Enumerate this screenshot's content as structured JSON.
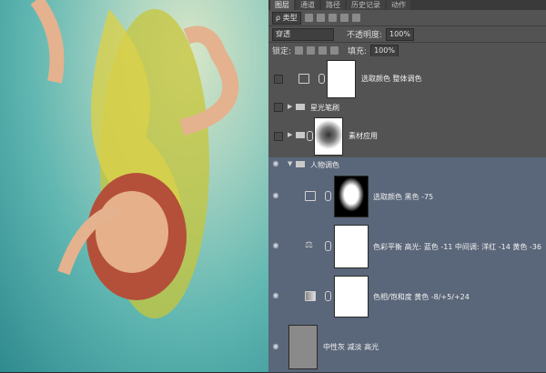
{
  "tabs": [
    "图层",
    "通道",
    "路径",
    "历史记录",
    "动作"
  ],
  "filter": {
    "label": "ρ 类型"
  },
  "blend": {
    "mode": "穿透",
    "opacity_label": "不透明度:",
    "opacity": "100%"
  },
  "lock": {
    "label": "锁定:",
    "fill_label": "填充:",
    "fill": "100%"
  },
  "layers": [
    {
      "name": "选取颜色 整体调色"
    },
    {
      "name": "星光笔刷"
    },
    {
      "name": "素材应用"
    },
    {
      "name": "人物调色"
    },
    {
      "name": "选取颜色 黑色 -75"
    },
    {
      "name": "色彩平衡 高光: 蓝色 -11 中间调: 洋红 -14 黄色 -36"
    },
    {
      "name": "色相/饱和度 黄色 -8/+5/+24"
    },
    {
      "name": "中性灰 减淡 高光"
    }
  ]
}
